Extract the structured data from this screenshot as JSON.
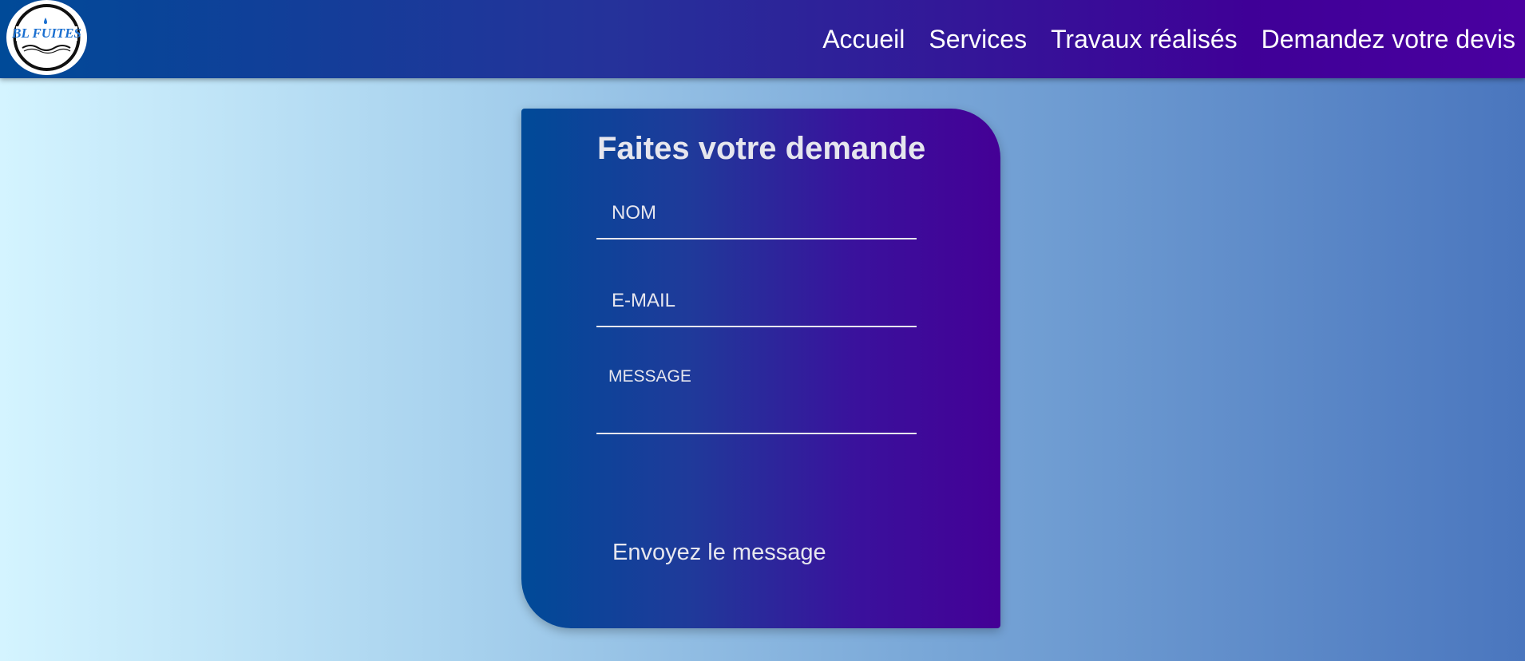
{
  "navbar": {
    "logo_text": "BL FUITES",
    "links": [
      {
        "label": "Accueil"
      },
      {
        "label": "Services"
      },
      {
        "label": "Travaux réalisés"
      },
      {
        "label": "Demandez votre devis"
      }
    ]
  },
  "form": {
    "title": "Faites votre demande",
    "fields": {
      "name": {
        "placeholder": "NOM",
        "value": ""
      },
      "email": {
        "placeholder": "E-MAIL",
        "value": ""
      },
      "message": {
        "placeholder": "MESSAGE",
        "value": ""
      }
    },
    "submit_label": "Envoyez le message"
  },
  "colors": {
    "nav_gradient_start": "#004a98",
    "nav_gradient_end": "#4a00a0",
    "page_gradient_start": "#d4f4ff",
    "page_gradient_end": "#4a76be",
    "card_gradient_start": "#004a98",
    "card_gradient_end": "#440096",
    "form_text": "#e6e6ee",
    "logo_text": "#1a6fd0"
  }
}
